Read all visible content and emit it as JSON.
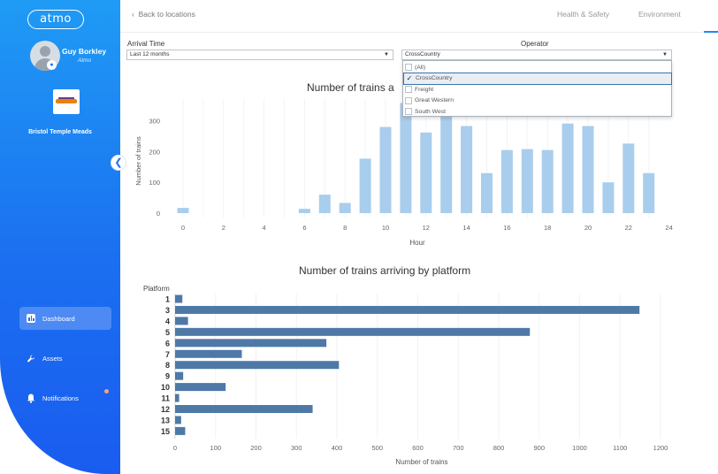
{
  "sidebar": {
    "logo_text": "atmo",
    "user_name": "Guy Borkley",
    "user_org": "Atmo",
    "station_name": "Bristol Temple Meads",
    "nav": [
      {
        "label": "Dashboard",
        "icon": "bar-chart-icon",
        "active": true
      },
      {
        "label": "Assets",
        "icon": "wrench-icon",
        "active": false
      },
      {
        "label": "Notifications",
        "icon": "bell-icon",
        "active": false
      }
    ],
    "collapse_icon": "chevron-left-icon"
  },
  "topbar": {
    "back_label": "Back to locations",
    "tabs": [
      "Health & Safety",
      "Environment"
    ]
  },
  "filters": {
    "arrival_label": "Arrival Time",
    "arrival_value": "Last 12 months",
    "operator_label": "Operator",
    "operator_value": "CrossCountry",
    "operator_options": [
      {
        "label": "(All)",
        "checked": false
      },
      {
        "label": "CrossCountry",
        "checked": true
      },
      {
        "label": "Freight",
        "checked": false
      },
      {
        "label": "Great Western",
        "checked": false
      },
      {
        "label": "South West",
        "checked": false
      }
    ]
  },
  "colors": {
    "sidebar_top": "#1f9bf5",
    "sidebar_bottom": "#1a5cf0",
    "hour_bar": "#a9cdec",
    "platform_bar": "#4e79a7"
  },
  "chart_data": [
    {
      "type": "bar",
      "title": "Number of trains a",
      "xlabel": "Hour",
      "ylabel": "Number of trains",
      "x": [
        0,
        1,
        2,
        3,
        4,
        5,
        6,
        7,
        8,
        9,
        10,
        11,
        12,
        13,
        14,
        15,
        16,
        17,
        18,
        19,
        20,
        21,
        22,
        23
      ],
      "values": [
        17,
        0,
        0,
        0,
        0,
        0,
        14,
        60,
        33,
        177,
        280,
        358,
        262,
        339,
        283,
        130,
        205,
        208,
        205,
        291,
        283,
        100,
        226,
        130
      ],
      "xticks": [
        0,
        2,
        4,
        6,
        8,
        10,
        12,
        14,
        16,
        18,
        20,
        22,
        24
      ],
      "yticks": [
        0,
        100,
        200,
        300
      ],
      "xlim": [
        -1,
        24
      ],
      "ylim": [
        0,
        370
      ]
    },
    {
      "type": "bar",
      "orientation": "horizontal",
      "title": "Number of trains arriving by platform",
      "xlabel": "Number of trains",
      "ylabel": "Platform",
      "categories": [
        "1",
        "3",
        "4",
        "5",
        "6",
        "7",
        "8",
        "9",
        "10",
        "11",
        "12",
        "13",
        "15"
      ],
      "values": [
        18,
        1148,
        32,
        877,
        374,
        165,
        405,
        20,
        125,
        10,
        340,
        15,
        25
      ],
      "xticks": [
        0,
        100,
        200,
        300,
        400,
        500,
        600,
        700,
        800,
        900,
        1000,
        1100,
        1200
      ],
      "xlim": [
        0,
        1200
      ]
    }
  ]
}
